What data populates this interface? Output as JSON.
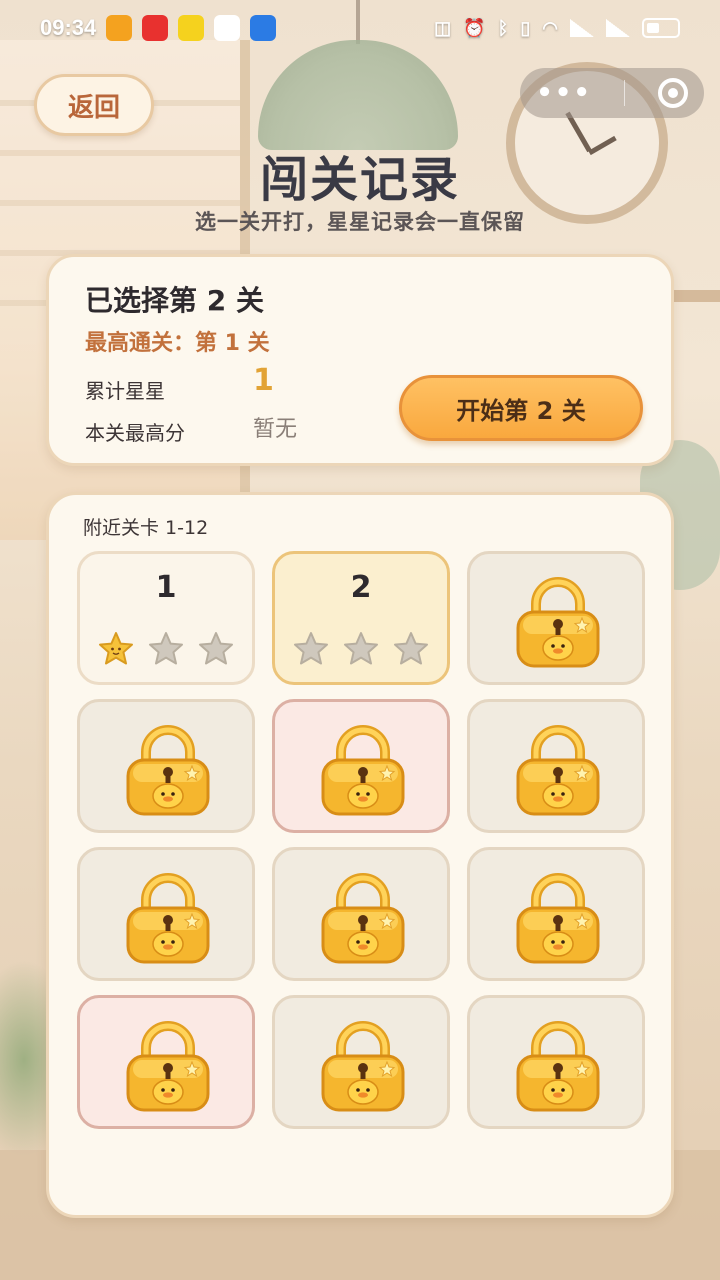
{
  "status_bar": {
    "time": "09:34",
    "apps": [
      {
        "name": "app-icon-1",
        "color": "#f4a21f"
      },
      {
        "name": "app-icon-2",
        "color": "#e8312f"
      },
      {
        "name": "app-icon-3",
        "color": "#f5d21e"
      },
      {
        "name": "app-icon-4",
        "color": "#ffffff"
      },
      {
        "name": "app-icon-5",
        "color": "#2b7be4"
      }
    ]
  },
  "header": {
    "back_label": "返回",
    "title": "闯关记录",
    "subtitle": "选一关开打，星星记录会一直保留"
  },
  "info": {
    "selected": "已选择第 2 关",
    "best_clear": "最高通关：第 1 关",
    "stars_label": "累计星星",
    "stars_value": "1",
    "score_label": "本关最高分",
    "score_value": "暂无",
    "start_label": "开始第 2 关"
  },
  "levels": {
    "label": "附近关卡 1-12",
    "cells": [
      {
        "num": "1",
        "locked": false,
        "stars": 1,
        "state": "cleared"
      },
      {
        "num": "2",
        "locked": false,
        "stars": 0,
        "state": "selected"
      },
      {
        "locked": true,
        "state": "locked"
      },
      {
        "locked": true,
        "state": "locked"
      },
      {
        "locked": true,
        "state": "pink"
      },
      {
        "locked": true,
        "state": "locked"
      },
      {
        "locked": true,
        "state": "locked"
      },
      {
        "locked": true,
        "state": "locked"
      },
      {
        "locked": true,
        "state": "locked"
      },
      {
        "locked": true,
        "state": "pink"
      },
      {
        "locked": true,
        "state": "locked"
      },
      {
        "locked": true,
        "state": "locked"
      }
    ]
  },
  "colors": {
    "accent": "#f9a83e",
    "star_gold": "#f6c23a",
    "star_empty": "#cfc8bd"
  }
}
